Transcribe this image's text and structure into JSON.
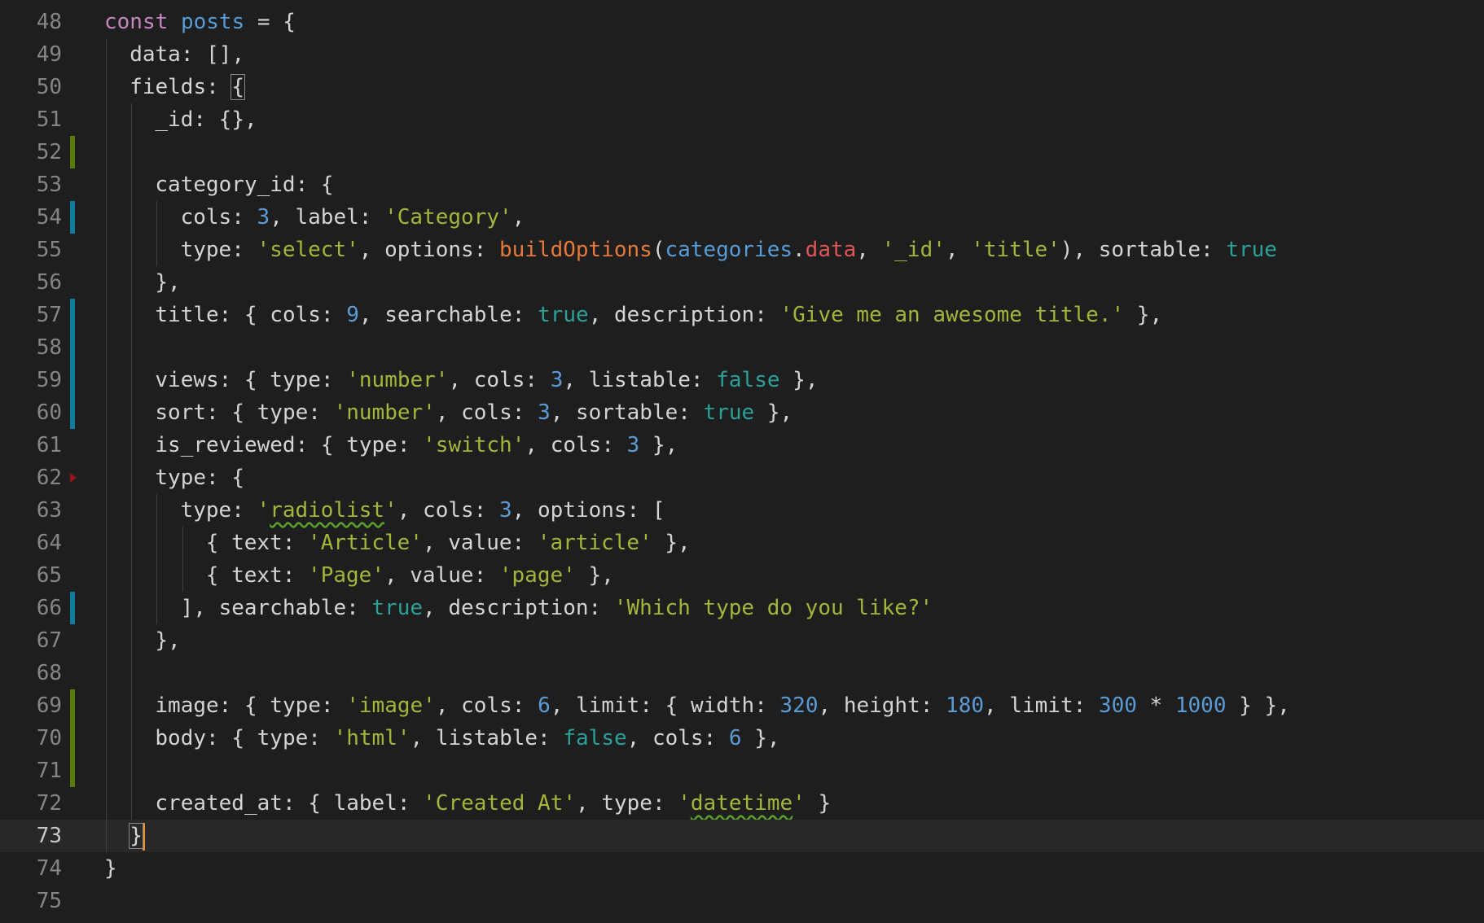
{
  "editor": {
    "current_line": 73,
    "lines": [
      {
        "n": "48",
        "diff": "",
        "guides": 0,
        "tokens": [
          [
            "kw",
            "const"
          ],
          [
            "t",
            " "
          ],
          [
            "var",
            "posts"
          ],
          [
            "t",
            " "
          ],
          [
            "op",
            "="
          ],
          [
            "t",
            " "
          ],
          [
            "punc",
            "{"
          ]
        ]
      },
      {
        "n": "49",
        "diff": "",
        "guides": 1,
        "tokens": [
          [
            "prop",
            "data"
          ],
          [
            "punc",
            ": []"
          ],
          [
            "punc",
            ","
          ]
        ]
      },
      {
        "n": "50",
        "diff": "",
        "guides": 1,
        "tokens": [
          [
            "prop",
            "fields"
          ],
          [
            "punc",
            ": "
          ],
          [
            "box",
            "{"
          ]
        ]
      },
      {
        "n": "51",
        "diff": "",
        "guides": 2,
        "tokens": [
          [
            "prop",
            "_id"
          ],
          [
            "punc",
            ": {},"
          ]
        ]
      },
      {
        "n": "52",
        "diff": "added",
        "guides": 2,
        "tokens": []
      },
      {
        "n": "53",
        "diff": "",
        "guides": 2,
        "tokens": [
          [
            "prop",
            "category_id"
          ],
          [
            "punc",
            ": {"
          ]
        ]
      },
      {
        "n": "54",
        "diff": "modified",
        "guides": 3,
        "tokens": [
          [
            "prop",
            "cols"
          ],
          [
            "punc",
            ": "
          ],
          [
            "num",
            "3"
          ],
          [
            "punc",
            ", "
          ],
          [
            "prop",
            "label"
          ],
          [
            "punc",
            ": "
          ],
          [
            "str",
            "'Category'"
          ],
          [
            "punc",
            ","
          ]
        ]
      },
      {
        "n": "55",
        "diff": "",
        "guides": 3,
        "tokens": [
          [
            "prop",
            "type"
          ],
          [
            "punc",
            ": "
          ],
          [
            "str",
            "'select'"
          ],
          [
            "punc",
            ", "
          ],
          [
            "prop",
            "options"
          ],
          [
            "punc",
            ": "
          ],
          [
            "fn",
            "buildOptions"
          ],
          [
            "punc",
            "("
          ],
          [
            "obj",
            "categories"
          ],
          [
            "punc",
            "."
          ],
          [
            "member",
            "data"
          ],
          [
            "punc",
            ", "
          ],
          [
            "str",
            "'_id'"
          ],
          [
            "punc",
            ", "
          ],
          [
            "str",
            "'title'"
          ],
          [
            "punc",
            "), "
          ],
          [
            "prop",
            "sortable"
          ],
          [
            "punc",
            ": "
          ],
          [
            "bool",
            "true"
          ]
        ]
      },
      {
        "n": "56",
        "diff": "",
        "guides": 2,
        "tokens": [
          [
            "punc",
            "},"
          ]
        ]
      },
      {
        "n": "57",
        "diff": "modified",
        "guides": 2,
        "tokens": [
          [
            "prop",
            "title"
          ],
          [
            "punc",
            ": { "
          ],
          [
            "prop",
            "cols"
          ],
          [
            "punc",
            ": "
          ],
          [
            "num",
            "9"
          ],
          [
            "punc",
            ", "
          ],
          [
            "prop",
            "searchable"
          ],
          [
            "punc",
            ": "
          ],
          [
            "bool",
            "true"
          ],
          [
            "punc",
            ", "
          ],
          [
            "prop",
            "description"
          ],
          [
            "punc",
            ": "
          ],
          [
            "str",
            "'Give me an awesome title.'"
          ],
          [
            "punc",
            " },"
          ]
        ]
      },
      {
        "n": "58",
        "diff": "modified",
        "guides": 2,
        "tokens": []
      },
      {
        "n": "59",
        "diff": "modified",
        "guides": 2,
        "tokens": [
          [
            "prop",
            "views"
          ],
          [
            "punc",
            ": { "
          ],
          [
            "prop",
            "type"
          ],
          [
            "punc",
            ": "
          ],
          [
            "str",
            "'number'"
          ],
          [
            "punc",
            ", "
          ],
          [
            "prop",
            "cols"
          ],
          [
            "punc",
            ": "
          ],
          [
            "num",
            "3"
          ],
          [
            "punc",
            ", "
          ],
          [
            "prop",
            "listable"
          ],
          [
            "punc",
            ": "
          ],
          [
            "bool",
            "false"
          ],
          [
            "punc",
            " },"
          ]
        ]
      },
      {
        "n": "60",
        "diff": "modified",
        "guides": 2,
        "tokens": [
          [
            "prop",
            "sort"
          ],
          [
            "punc",
            ": { "
          ],
          [
            "prop",
            "type"
          ],
          [
            "punc",
            ": "
          ],
          [
            "str",
            "'number'"
          ],
          [
            "punc",
            ", "
          ],
          [
            "prop",
            "cols"
          ],
          [
            "punc",
            ": "
          ],
          [
            "num",
            "3"
          ],
          [
            "punc",
            ", "
          ],
          [
            "prop",
            "sortable"
          ],
          [
            "punc",
            ": "
          ],
          [
            "bool",
            "true"
          ],
          [
            "punc",
            " },"
          ]
        ]
      },
      {
        "n": "61",
        "diff": "",
        "guides": 2,
        "tokens": [
          [
            "prop",
            "is_reviewed"
          ],
          [
            "punc",
            ": { "
          ],
          [
            "prop",
            "type"
          ],
          [
            "punc",
            ": "
          ],
          [
            "str",
            "'switch'"
          ],
          [
            "punc",
            ", "
          ],
          [
            "prop",
            "cols"
          ],
          [
            "punc",
            ": "
          ],
          [
            "num",
            "3"
          ],
          [
            "punc",
            " },"
          ]
        ]
      },
      {
        "n": "62",
        "diff": "deleted",
        "guides": 2,
        "tokens": [
          [
            "prop",
            "type"
          ],
          [
            "punc",
            ": {"
          ]
        ]
      },
      {
        "n": "63",
        "diff": "",
        "guides": 3,
        "tokens": [
          [
            "prop",
            "type"
          ],
          [
            "punc",
            ": "
          ],
          [
            "str",
            "'"
          ],
          [
            "sq",
            "radiolist"
          ],
          [
            "str",
            "'"
          ],
          [
            "punc",
            ", "
          ],
          [
            "prop",
            "cols"
          ],
          [
            "punc",
            ": "
          ],
          [
            "num",
            "3"
          ],
          [
            "punc",
            ", "
          ],
          [
            "prop",
            "options"
          ],
          [
            "punc",
            ": ["
          ]
        ]
      },
      {
        "n": "64",
        "diff": "",
        "guides": 4,
        "tokens": [
          [
            "punc",
            "{ "
          ],
          [
            "prop",
            "text"
          ],
          [
            "punc",
            ": "
          ],
          [
            "str",
            "'Article'"
          ],
          [
            "punc",
            ", "
          ],
          [
            "prop",
            "value"
          ],
          [
            "punc",
            ": "
          ],
          [
            "str",
            "'article'"
          ],
          [
            "punc",
            " },"
          ]
        ]
      },
      {
        "n": "65",
        "diff": "",
        "guides": 4,
        "tokens": [
          [
            "punc",
            "{ "
          ],
          [
            "prop",
            "text"
          ],
          [
            "punc",
            ": "
          ],
          [
            "str",
            "'Page'"
          ],
          [
            "punc",
            ", "
          ],
          [
            "prop",
            "value"
          ],
          [
            "punc",
            ": "
          ],
          [
            "str",
            "'page'"
          ],
          [
            "punc",
            " },"
          ]
        ]
      },
      {
        "n": "66",
        "diff": "modified",
        "guides": 3,
        "tokens": [
          [
            "punc",
            "], "
          ],
          [
            "prop",
            "searchable"
          ],
          [
            "punc",
            ": "
          ],
          [
            "bool",
            "true"
          ],
          [
            "punc",
            ", "
          ],
          [
            "prop",
            "description"
          ],
          [
            "punc",
            ": "
          ],
          [
            "str",
            "'Which type do you like?'"
          ]
        ]
      },
      {
        "n": "67",
        "diff": "",
        "guides": 2,
        "tokens": [
          [
            "punc",
            "},"
          ]
        ]
      },
      {
        "n": "68",
        "diff": "",
        "guides": 2,
        "tokens": []
      },
      {
        "n": "69",
        "diff": "added",
        "guides": 2,
        "tokens": [
          [
            "prop",
            "image"
          ],
          [
            "punc",
            ": { "
          ],
          [
            "prop",
            "type"
          ],
          [
            "punc",
            ": "
          ],
          [
            "str",
            "'image'"
          ],
          [
            "punc",
            ", "
          ],
          [
            "prop",
            "cols"
          ],
          [
            "punc",
            ": "
          ],
          [
            "num",
            "6"
          ],
          [
            "punc",
            ", "
          ],
          [
            "prop",
            "limit"
          ],
          [
            "punc",
            ": { "
          ],
          [
            "prop",
            "width"
          ],
          [
            "punc",
            ": "
          ],
          [
            "num",
            "320"
          ],
          [
            "punc",
            ", "
          ],
          [
            "prop",
            "height"
          ],
          [
            "punc",
            ": "
          ],
          [
            "num",
            "180"
          ],
          [
            "punc",
            ", "
          ],
          [
            "prop",
            "limit"
          ],
          [
            "punc",
            ": "
          ],
          [
            "num",
            "300"
          ],
          [
            "punc",
            " "
          ],
          [
            "op",
            "*"
          ],
          [
            "punc",
            " "
          ],
          [
            "num",
            "1000"
          ],
          [
            "punc",
            " } },"
          ]
        ]
      },
      {
        "n": "70",
        "diff": "added",
        "guides": 2,
        "tokens": [
          [
            "prop",
            "body"
          ],
          [
            "punc",
            ": { "
          ],
          [
            "prop",
            "type"
          ],
          [
            "punc",
            ": "
          ],
          [
            "str",
            "'html'"
          ],
          [
            "punc",
            ", "
          ],
          [
            "prop",
            "listable"
          ],
          [
            "punc",
            ": "
          ],
          [
            "bool",
            "false"
          ],
          [
            "punc",
            ", "
          ],
          [
            "prop",
            "cols"
          ],
          [
            "punc",
            ": "
          ],
          [
            "num",
            "6"
          ],
          [
            "punc",
            " },"
          ]
        ]
      },
      {
        "n": "71",
        "diff": "added",
        "guides": 2,
        "tokens": []
      },
      {
        "n": "72",
        "diff": "",
        "guides": 2,
        "tokens": [
          [
            "prop",
            "created_at"
          ],
          [
            "punc",
            ": { "
          ],
          [
            "prop",
            "label"
          ],
          [
            "punc",
            ": "
          ],
          [
            "str",
            "'Created At'"
          ],
          [
            "punc",
            ", "
          ],
          [
            "prop",
            "type"
          ],
          [
            "punc",
            ": "
          ],
          [
            "str",
            "'"
          ],
          [
            "sq",
            "datetime"
          ],
          [
            "str",
            "'"
          ],
          [
            "punc",
            " }"
          ]
        ]
      },
      {
        "n": "73",
        "diff": "",
        "guides": 1,
        "tokens": [
          [
            "box",
            "}"
          ],
          [
            "cursor",
            ""
          ]
        ]
      },
      {
        "n": "74",
        "diff": "",
        "guides": 0,
        "tokens": [
          [
            "punc",
            "}"
          ]
        ]
      },
      {
        "n": "75",
        "diff": "",
        "guides": 0,
        "tokens": []
      }
    ]
  }
}
